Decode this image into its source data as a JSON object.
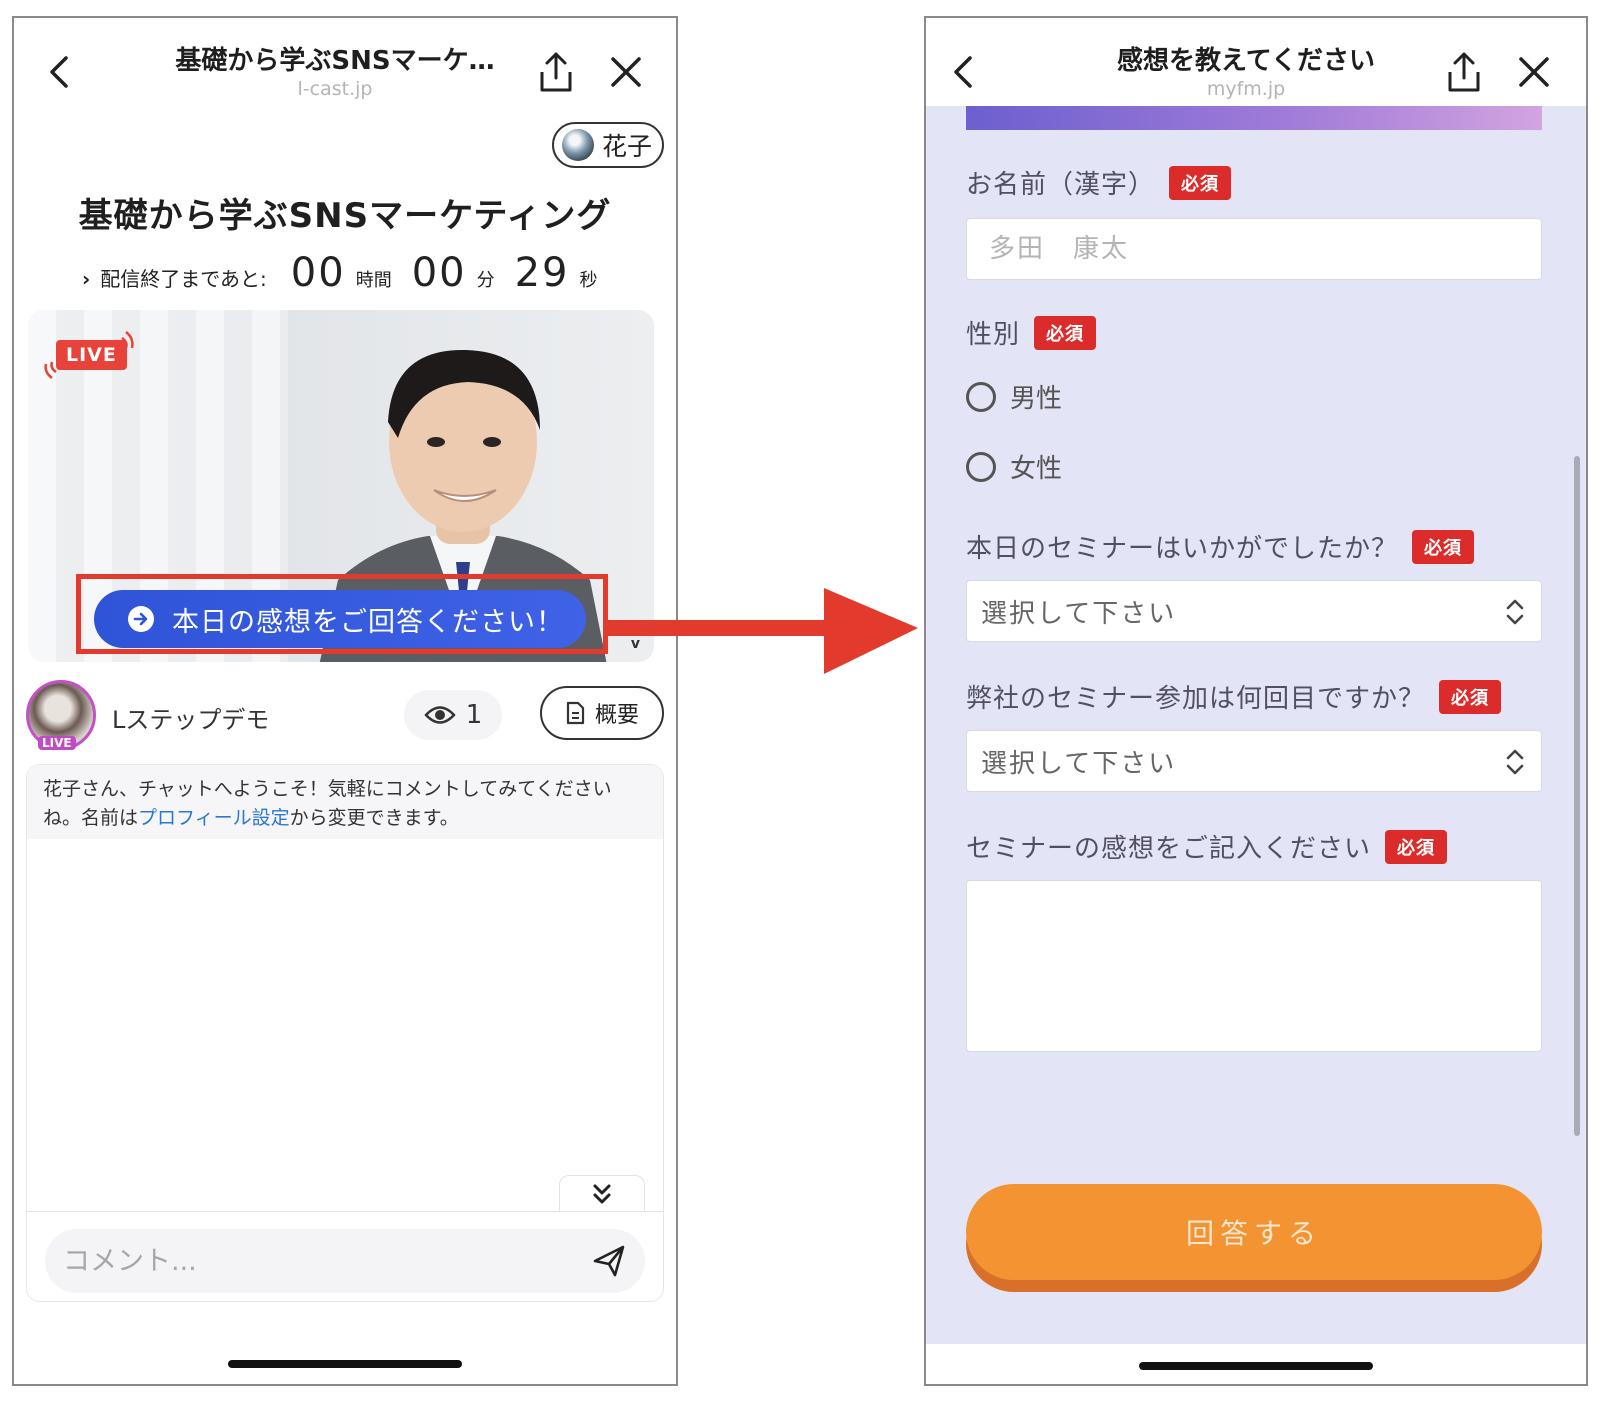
{
  "left": {
    "topbar": {
      "title": "基礎から学ぶSNSマーケ…",
      "url": "l-cast.jp"
    },
    "user": {
      "name": "花子"
    },
    "event_title": "基礎から学ぶSNSマーケティング",
    "countdown": {
      "chevron": "›",
      "label": "配信終了まであと:",
      "hours": "00",
      "hours_unit": "時間",
      "minutes": "00",
      "minutes_unit": "分",
      "seconds": "29",
      "seconds_unit": "秒"
    },
    "video": {
      "live_badge": "LIVE",
      "cta_label": "本日の感想をご回答ください！",
      "watermark": "v"
    },
    "channel": {
      "name": "Lステップデモ",
      "live_tag": "LIVE",
      "viewer_count": "1",
      "summary_label": "概要"
    },
    "chat": {
      "welcome_part1": "花子さん、チャットへようこそ！気軽にコメントしてみてくださいね。名前は",
      "welcome_link": "プロフィール設定",
      "welcome_part2": "から変更できます。",
      "comment_placeholder": "コメント..."
    }
  },
  "right": {
    "topbar": {
      "title": "感想を教えてください",
      "url": "myfm.jp"
    },
    "required_label": "必須",
    "name_field": {
      "label": "お名前（漢字）",
      "placeholder": "多田　康太"
    },
    "gender_field": {
      "label": "性別",
      "options": [
        "男性",
        "女性"
      ]
    },
    "q1": {
      "label": "本日のセミナーはいかがでしたか？",
      "value": "選択して下さい"
    },
    "q2": {
      "label": "弊社のセミナー参加は何回目ですか？",
      "value": "選択して下さい"
    },
    "q3": {
      "label": "セミナーの感想をご記入ください"
    },
    "submit_label": "回答する"
  },
  "colors": {
    "accent_blue": "#2f54d8",
    "highlight_red": "#e23b2e",
    "required_red": "#db2b2b",
    "submit_orange": "#f39332",
    "form_bg": "#e3e4f6"
  }
}
